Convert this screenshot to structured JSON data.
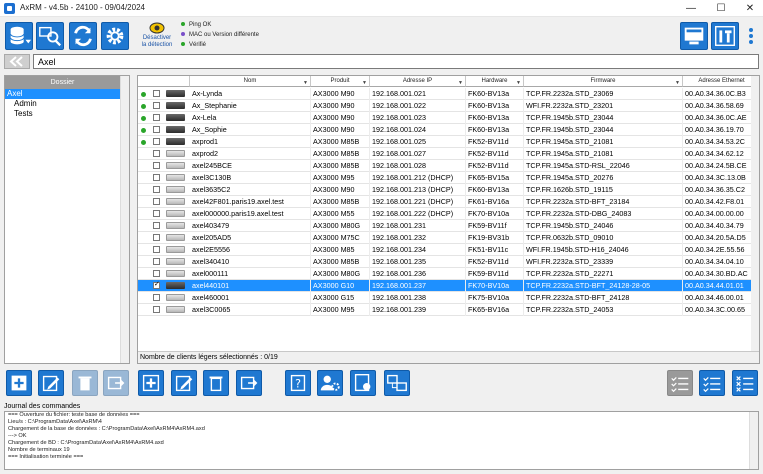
{
  "window": {
    "title": "AxRM - v4.5b - 24100 - 09/04/2024"
  },
  "toolbar": {
    "detect_label_1": "Désactiver",
    "detect_label_2": "la détection",
    "legend": [
      "Ping OK",
      "MAC ou Version différente",
      "Vérifié"
    ],
    "legend_colors": [
      "#2aa52a",
      "#7a4fc9",
      "#2aa52a"
    ]
  },
  "search": {
    "value": "Axel"
  },
  "tree": {
    "header": "Dossier",
    "items": [
      "Axel",
      "Admin",
      "Tests"
    ]
  },
  "grid": {
    "columns": [
      "Nom",
      "Produit",
      "Adresse IP",
      "Hardware",
      "Firmware",
      "Adresse Ethernet"
    ],
    "footer": "Nombre de clients légers sélectionnés : 0/19",
    "rows": [
      {
        "status": true,
        "dev": "dark",
        "name": "Ax-Lynda",
        "product": "AX3000 M90",
        "ip": "192.168.001.021",
        "hw": "FK60-BV13a",
        "fw": "TCP.FR.2232a.STD_23069",
        "mac": "00.A0.34.36.0C.B3"
      },
      {
        "status": true,
        "dev": "dark",
        "name": "Ax_Stephanie",
        "product": "AX3000 M90",
        "ip": "192.168.001.022",
        "hw": "FK60-BV13a",
        "fw": "WFI.FR.2232a.STD_23201",
        "mac": "00.A0.34.36.58.69"
      },
      {
        "status": true,
        "dev": "dark",
        "name": "Ax-Lela",
        "product": "AX3000 M90",
        "ip": "192.168.001.023",
        "hw": "FK60-BV13a",
        "fw": "TCP.FR.1945b.STD_23044",
        "mac": "00.A0.34.36.0C.AE"
      },
      {
        "status": true,
        "dev": "dark",
        "name": "Ax_Sophie",
        "product": "AX3000 M90",
        "ip": "192.168.001.024",
        "hw": "FK60-BV13a",
        "fw": "TCP.FR.1945b.STD_23044",
        "mac": "00.A0.34.36.19.70"
      },
      {
        "status": true,
        "dev": "dark",
        "name": "axprod1",
        "product": "AX3000 M85B",
        "ip": "192.168.001.025",
        "hw": "FK52-BV11d",
        "fw": "TCP.FR.1945a.STD_21081",
        "mac": "00.A0.34.34.53.2C"
      },
      {
        "status": false,
        "dev": "light",
        "name": "axprod2",
        "product": "AX3000 M85B",
        "ip": "192.168.001.027",
        "hw": "FK52-BV11d",
        "fw": "TCP.FR.1945a.STD_21081",
        "mac": "00.A0.34.34.62.12"
      },
      {
        "status": false,
        "dev": "light",
        "name": "axel245BCE",
        "product": "AX3000 M85B",
        "ip": "192.168.001.028",
        "hw": "FK52-BV11d",
        "fw": "TCP.FR.1945a.STD-RSL_22046",
        "mac": "00.A0.34.24.5B.CE"
      },
      {
        "status": false,
        "dev": "light",
        "name": "axel3C130B",
        "product": "AX3000 M95",
        "ip": "192.168.001.212 (DHCP)",
        "hw": "FK65-BV15a",
        "fw": "TCP.FR.1945a.STD_20276",
        "mac": "00.A0.34.3C.13.0B"
      },
      {
        "status": false,
        "dev": "light",
        "name": "axel3635C2",
        "product": "AX3000 M90",
        "ip": "192.168.001.213 (DHCP)",
        "hw": "FK60-BV13a",
        "fw": "TCP.FR.1626b.STD_19115",
        "mac": "00.A0.34.36.35.C2"
      },
      {
        "status": false,
        "dev": "light",
        "name": "axel42F801.paris19.axel.test",
        "product": "AX3000 M85B",
        "ip": "192.168.001.221 (DHCP)",
        "hw": "FK61-BV16a",
        "fw": "TCP.FR.2232a.STD-BFT_23184",
        "mac": "00.A0.34.42.F8.01"
      },
      {
        "status": false,
        "dev": "light",
        "name": "axel000000.paris19.axel.test",
        "product": "AX3000 M55",
        "ip": "192.168.001.222 (DHCP)",
        "hw": "FK70-BV10a",
        "fw": "TCP.FR.2232a.STD-DBG_24083",
        "mac": "00.A0.34.00.00.00"
      },
      {
        "status": false,
        "dev": "light",
        "name": "axel403479",
        "product": "AX3000 M80G",
        "ip": "192.168.001.231",
        "hw": "FK59-BV11f",
        "fw": "TCP.FR.1945b.STD_24046",
        "mac": "00.A0.34.40.34.79"
      },
      {
        "status": false,
        "dev": "light",
        "name": "axel205AD5",
        "product": "AX3000 M75C",
        "ip": "192.168.001.232",
        "hw": "FK19-BV31b",
        "fw": "TCP.FR.0632b.STD_09010",
        "mac": "00.A0.34.20.5A.D5"
      },
      {
        "status": false,
        "dev": "light",
        "name": "axel2E5556",
        "product": "AX3000 M85",
        "ip": "192.168.001.234",
        "hw": "FK51-BV11c",
        "fw": "WFI.FR.1945b.STD-H16_24046",
        "mac": "00.A0.34.2E.55.56"
      },
      {
        "status": false,
        "dev": "light",
        "name": "axel340410",
        "product": "AX3000 M85B",
        "ip": "192.168.001.235",
        "hw": "FK52-BV11d",
        "fw": "WFI.FR.2232a.STD_23339",
        "mac": "00.A0.34.34.04.10"
      },
      {
        "status": false,
        "dev": "light",
        "name": "axel000111",
        "product": "AX3000 M80G",
        "ip": "192.168.001.236",
        "hw": "FK59-BV11d",
        "fw": "TCP.FR.2232a.STD_22271",
        "mac": "00.A0.34.30.BD.AC"
      },
      {
        "status": false,
        "dev": "dark",
        "name": "axel440101",
        "product": "AX3000 G10",
        "ip": "192.168.001.237",
        "hw": "FK70-BV10a",
        "fw": "TCP.FR.2232a.STD-BFT_24128-28-05",
        "mac": "00.A0.34.44.01.01",
        "selected": true,
        "checked": true
      },
      {
        "status": false,
        "dev": "light",
        "name": "axel460001",
        "product": "AX3000 G15",
        "ip": "192.168.001.238",
        "hw": "FK75-BV10a",
        "fw": "TCP.FR.2232a.STD-BFT_24128",
        "mac": "00.A0.34.46.00.01"
      },
      {
        "status": false,
        "dev": "light",
        "name": "axel3C0065",
        "product": "AX3000 M95",
        "ip": "192.168.001.239",
        "hw": "FK65-BV16a",
        "fw": "TCP.FR.2232a.STD_24053",
        "mac": "00.A0.34.3C.00.65"
      }
    ]
  },
  "log": {
    "label": "Journal des commandes",
    "lines": [
      "=== Ouverture du fichier: teste base de données ===",
      "Lieu/s : C:\\ProgramData\\Axel\\AxRM\\4",
      "Chargement de la base de données : C:\\ProgramData\\Axel\\AxRM4\\AxRM4.axd",
      "  ---> OK",
      "Chargement de BD : C:\\ProgramData\\Axel\\AxRM4\\AxRM4.axd",
      "Nombre de terminaux 19",
      "=== Initialisation terminée ==="
    ]
  }
}
